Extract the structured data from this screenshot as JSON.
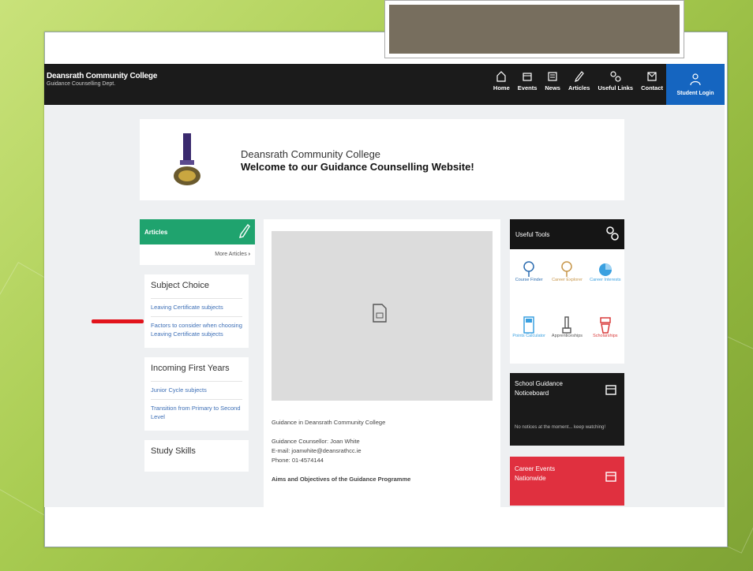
{
  "site": {
    "name": "Deansrath Community College",
    "dept": "Guidance Counselling Dept."
  },
  "nav": {
    "items": [
      {
        "label": "Home",
        "icon": "home-icon"
      },
      {
        "label": "Events",
        "icon": "calendar-icon"
      },
      {
        "label": "News",
        "icon": "newspaper-icon"
      },
      {
        "label": "Articles",
        "icon": "pencil-icon"
      },
      {
        "label": "Useful Links",
        "icon": "link-icon"
      },
      {
        "label": "Contact",
        "icon": "envelope-icon"
      }
    ],
    "login_label": "Student Login"
  },
  "welcome": {
    "line1": "Deansrath Community College",
    "line2": "Welcome to our Guidance Counselling Website!"
  },
  "articles": {
    "header": "Articles",
    "more": "More Articles",
    "sections": [
      {
        "title": "Subject Choice",
        "links": [
          "Leaving Certificate subjects",
          "Factors to consider when choosing Leaving Certificate subjects"
        ]
      },
      {
        "title": "Incoming First Years",
        "links": [
          "Junior Cycle subjects",
          "Transition from Primary to Second Level"
        ]
      },
      {
        "title": "Study Skills",
        "links": []
      }
    ]
  },
  "main": {
    "lines": [
      "Guidance in Deansrath Community College",
      "",
      "Guidance Counsellor: Joan White",
      "E-mail: joanwhite@deansrathcc.ie",
      "Phone: 01-4574144",
      "",
      "Aims and Objectives of the Guidance Programme"
    ]
  },
  "tools": {
    "header": "Useful Tools",
    "items": [
      {
        "label": "Course Finder",
        "color": "#2b6cb0"
      },
      {
        "label": "Career Explorer",
        "color": "#c7964a"
      },
      {
        "label": "Career Interests",
        "color": "#3aa0e0"
      },
      {
        "label": "Points Calculator",
        "color": "#3aa0e0"
      },
      {
        "label": "Apprenticeships",
        "color": "#555555"
      },
      {
        "label": "Scholarships",
        "color": "#d93a3a"
      }
    ]
  },
  "notice": {
    "title": "School Guidance Noticeboard",
    "message": "No notices at the moment... keep watching!"
  },
  "career": {
    "title": "Career Events Nationwide"
  },
  "colors": {
    "navbar": "#1b1b1b",
    "login": "#1565c0",
    "articles_header": "#1fa36e",
    "career": "#e0303f",
    "link": "#3d6fb6",
    "annotation_arrow": "#e2141c"
  }
}
